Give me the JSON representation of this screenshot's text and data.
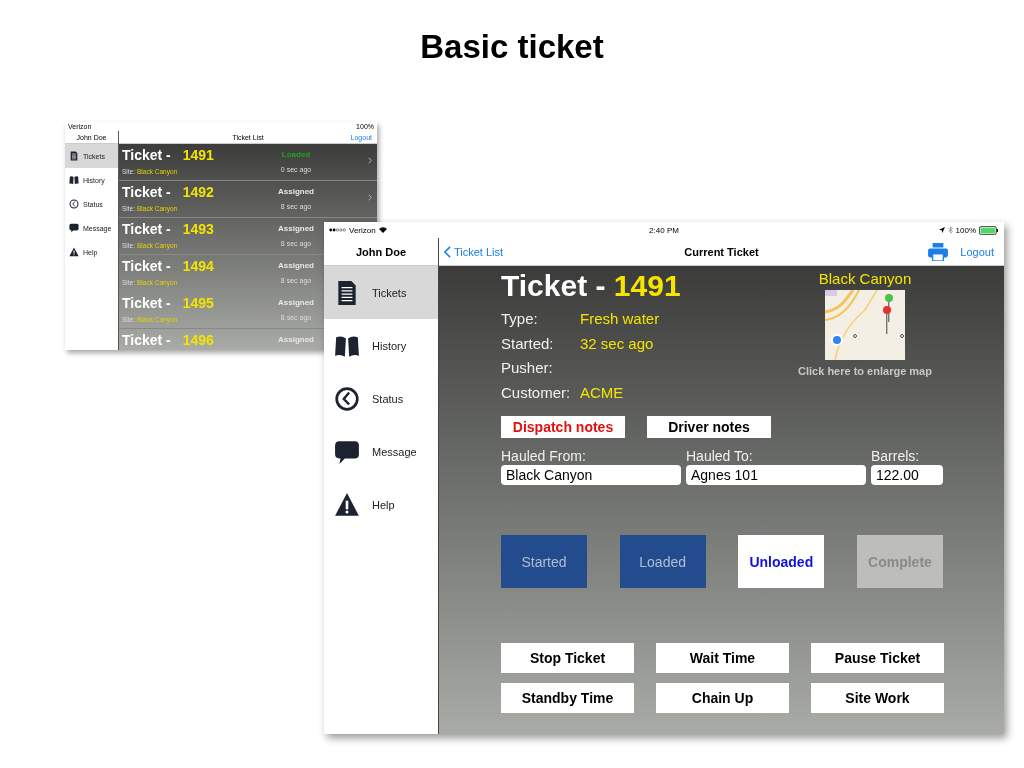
{
  "slide_title": "Basic ticket",
  "list_screen": {
    "carrier": "Verizon",
    "battery": "100%",
    "user": "John Doe",
    "nav_title": "Ticket List",
    "logout": "Logout",
    "sidebar": [
      {
        "label": "Tickets",
        "selected": true
      },
      {
        "label": "History",
        "selected": false
      },
      {
        "label": "Status",
        "selected": false
      },
      {
        "label": "Message",
        "selected": false
      },
      {
        "label": "Help",
        "selected": false
      }
    ],
    "tickets": [
      {
        "label": "Ticket -",
        "number": "1491",
        "status": "Loaded",
        "color": "#1fa31f",
        "site_label": "Site:",
        "site": "Black Canyon",
        "time": "0 sec ago",
        "chevron": true
      },
      {
        "label": "Ticket -",
        "number": "1492",
        "status": "Assigned",
        "color": "#e8e8e8",
        "site_label": "Site:",
        "site": "Black Canyon",
        "time": "8 sec ago",
        "chevron": true
      },
      {
        "label": "Ticket -",
        "number": "1493",
        "status": "Assigned",
        "color": "#e8e8e8",
        "site_label": "Site:",
        "site": "Black Canyon",
        "time": "8 sec ago",
        "chevron": false
      },
      {
        "label": "Ticket -",
        "number": "1494",
        "status": "Assigned",
        "color": "#e8e8e8",
        "site_label": "Site:",
        "site": "Black Canyon",
        "time": "8 sec ago",
        "chevron": false
      },
      {
        "label": "Ticket -",
        "number": "1495",
        "status": "Assigned",
        "color": "#e8e8e8",
        "site_label": "Site:",
        "site": "Black Canyon",
        "time": "8 sec ago",
        "chevron": false
      },
      {
        "label": "Ticket -",
        "number": "1496",
        "status": "Assigned",
        "color": "#e8e8e8",
        "chevron": false
      }
    ]
  },
  "ticket_screen": {
    "carrier": "Verizon",
    "time": "2:40 PM",
    "battery": "100%",
    "user": "John Doe",
    "back": "Ticket List",
    "nav_title": "Current Ticket",
    "logout": "Logout",
    "sidebar": [
      {
        "label": "Tickets",
        "selected": true
      },
      {
        "label": "History",
        "selected": false
      },
      {
        "label": "Status",
        "selected": false
      },
      {
        "label": "Message",
        "selected": false
      },
      {
        "label": "Help",
        "selected": false
      }
    ],
    "ticket_label": "Ticket -",
    "ticket_number": "1491",
    "details": [
      {
        "label": "Type:",
        "value": "Fresh water"
      },
      {
        "label": "Started:",
        "value": "32 sec ago"
      },
      {
        "label": "Pusher:"
      },
      {
        "label": "Customer:",
        "value": "ACME"
      }
    ],
    "site": "Black Canyon",
    "map": {
      "kind": "picture",
      "caption": "Click here to enlarge map"
    },
    "notes": [
      {
        "label": "Dispatch notes",
        "kind": "alert"
      },
      {
        "label": "Driver notes",
        "kind": "plain"
      }
    ],
    "route": [
      {
        "label": "Hauled From:",
        "value": "Black Canyon"
      },
      {
        "label": "Hauled To:",
        "value": "Agnes 101"
      },
      {
        "label": "Barrels:",
        "value": "122.00"
      }
    ],
    "progress": [
      {
        "label": "Started",
        "done": true,
        "disabled": false
      },
      {
        "label": "Loaded",
        "done": true,
        "disabled": false
      },
      {
        "label": "Unloaded",
        "done": false,
        "disabled": false
      },
      {
        "label": "Complete",
        "done": false,
        "disabled": true
      }
    ],
    "actions": [
      "Stop Ticket",
      "Wait Time",
      "Pause Ticket",
      "Standby Time",
      "Chain Up",
      "Site Work"
    ]
  }
}
